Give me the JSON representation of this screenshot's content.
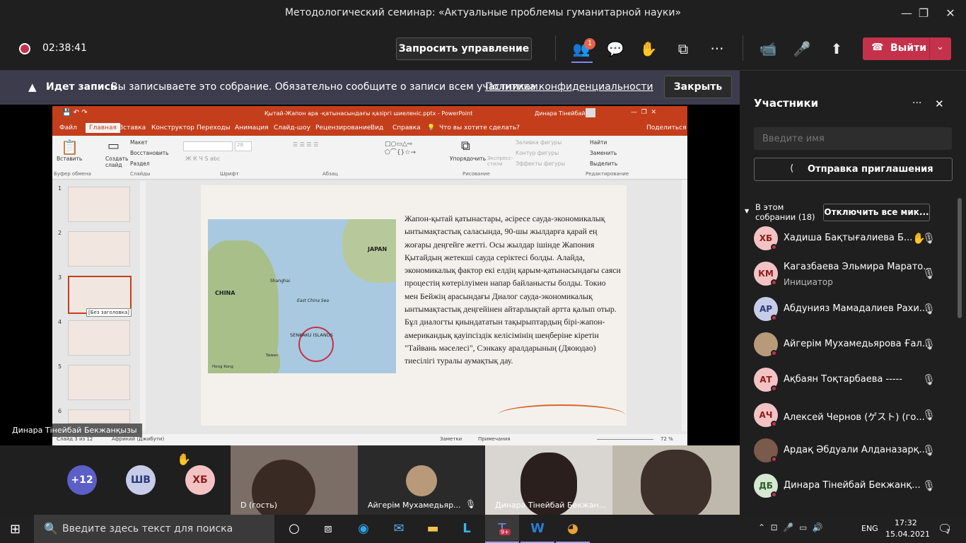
{
  "window": {
    "title": "Методологический семинар: «Актуальные проблемы гуманитарной науки»",
    "min": "—",
    "max": "❐",
    "close": "✕"
  },
  "toolbar": {
    "timer": "02:38:41",
    "request_control": "Запросить управление",
    "people_badge": "1",
    "more": "···",
    "leave": "Выйти"
  },
  "banner": {
    "recording": "Идет запись",
    "message": "Вы записываете это собрание. Обязательно сообщите о записи всем участникам.",
    "policy_link": "Политика конфиденциальности",
    "close_button": "Закрыть"
  },
  "powerpoint": {
    "title": "Қытай-Жапон ара -қатынасындағы қазіргі шиеленіс.pptx - PowerPoint",
    "user": "Динара Тінейбай",
    "tabs": [
      "Файл",
      "Главная",
      "Вставка",
      "Конструктор",
      "Переходы",
      "Анимация",
      "Слайд-шоу",
      "Рецензирование",
      "Вид",
      "Справка"
    ],
    "tell_me": "Что вы хотите сделать?",
    "share": "Поделиться",
    "groups": {
      "clipboard": "Буфер обмена",
      "slides": "Слайды",
      "font": "Шрифт",
      "paragraph": "Абзац",
      "drawing": "Рисование",
      "editing": "Редактирование"
    },
    "buttons": {
      "paste": "Вставить",
      "create_slide": "Создать слайд",
      "layout": "Макет",
      "reset": "Восстановить",
      "section": "Раздел",
      "arrange": "Упорядочить",
      "express": "Экспресс-стили",
      "fill": "Заливка фигуры",
      "outline": "Контур фигуры",
      "effects": "Эффекты фигуры",
      "find": "Найти",
      "replace": "Заменить",
      "select": "Выделить",
      "font_size": "28"
    },
    "thumbs": [
      "1",
      "2",
      "3",
      "4",
      "5",
      "6"
    ],
    "tooltip": "[Без заголовка]",
    "slide_text": "Жапон-қытай қатынастары, әсіресе сауда-экономикалық ынтымақтастық саласында, 90-шы жылдарға қарай ең жоғары деңгейге жетті. Осы жылдар ішінде Жапония Қытайдың жетекші сауда серіктесі болды. Алайда, экономикалық фактор екі елдің қарым-қатынасындағы саяси процестің көтерілуімен напар байланысты болды. Токио мен Бейжің арасындағы Диалог сауда-экономикалық ынтымақтастық деңгейінен айтарлықтай артта қалып отыр. Бұл диалогты қиындататын тақырыптардың бірі-жапон-американдық қауіпсіздік келісімінің шеңберіне кіретін \"Тайвань мәселесі\", Сэнкаку аралдарының (Дяоюдао) тиесілігі туралы аумақтық дау.",
    "map": {
      "japan": "JAPAN",
      "china": "CHINA",
      "shanghai": "Shanghai",
      "sea": "East China Sea",
      "islands": "SENKAKU ISLANDS",
      "taiwan": "Taiwan",
      "hongkong": "Hong Kong"
    },
    "status": {
      "slide": "Слайд 3 из 12",
      "lang": "Африкий (Джибути)",
      "notes": "Заметки",
      "comments": "Примечания",
      "zoom": "72 %"
    }
  },
  "presenter_label": "Динара Тінейбай Бекжанқызы",
  "tiles": {
    "more": "+12",
    "sv": "ШВ",
    "hb": "ХБ",
    "t1": "D (гость)",
    "t2": "Айгерім Мухамедьяр...",
    "t3": "Динара Тінейбай Бекжан..."
  },
  "panel": {
    "title": "Участники",
    "search_placeholder": "Введите имя",
    "invite": "Отправка приглашения",
    "in_meeting": "В этом собрании (18)",
    "mute_all": "Отключить все мик...",
    "participants": [
      {
        "initials": "ХБ",
        "name": "Хадиша Бақтығалиева Б...",
        "role": "",
        "bg": "#f3c3c3",
        "fg": "#8a1d1d",
        "hand": true
      },
      {
        "initials": "КМ",
        "name": "Кагазбаева Эльмира Марато...",
        "role": "Инициатор",
        "bg": "#f3c3c3",
        "fg": "#8a1d1d"
      },
      {
        "initials": "АР",
        "name": "Абдунияз Мамадалиев Рахи...",
        "role": "",
        "bg": "#c7cde8",
        "fg": "#2d3a7a"
      },
      {
        "initials": "",
        "name": "Айгерім Мухамедьярова Ғал...",
        "role": "",
        "bg": "#b89a7a",
        "fg": "#fff"
      },
      {
        "initials": "АТ",
        "name": "Ақбаян Тоқтарбаева -----",
        "role": "",
        "bg": "#f3c3c3",
        "fg": "#8a1d1d"
      },
      {
        "initials": "АЧ",
        "name": "Алексей Чернов (ゲスト) (го...",
        "role": "",
        "bg": "#f3c3c3",
        "fg": "#8a1d1d"
      },
      {
        "initials": "",
        "name": "Ардақ Әбдуали Алданазарқ...",
        "role": "",
        "bg": "#7a5a4a",
        "fg": "#fff"
      },
      {
        "initials": "ДБ",
        "name": "Динара Тінейбай Бекжанқ...",
        "role": "",
        "bg": "#d6e8d2",
        "fg": "#2f5a2a"
      }
    ]
  },
  "taskbar": {
    "search": "Введите здесь текст для поиска",
    "lang": "ENG",
    "time": "17:32",
    "date": "15.04.2021",
    "notif": "7",
    "teams_badge": "9+"
  }
}
